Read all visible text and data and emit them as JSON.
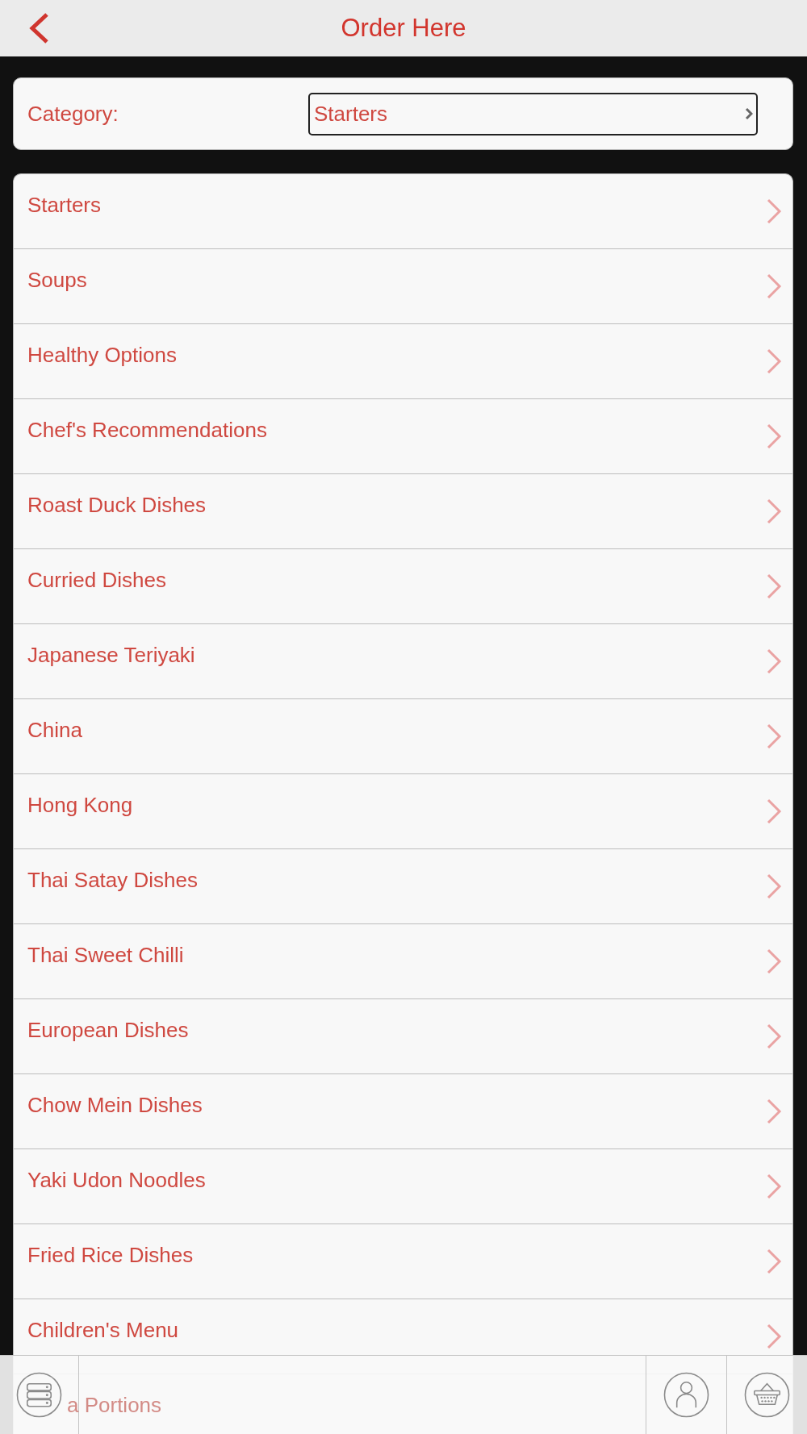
{
  "header": {
    "title": "Order Here"
  },
  "category": {
    "label": "Category:",
    "value": "Starters"
  },
  "menu_items": [
    {
      "label": "Starters"
    },
    {
      "label": "Soups"
    },
    {
      "label": "Healthy Options"
    },
    {
      "label": "Chef's Recommendations"
    },
    {
      "label": "Roast Duck Dishes"
    },
    {
      "label": "Curried Dishes"
    },
    {
      "label": "Japanese Teriyaki"
    },
    {
      "label": "China"
    },
    {
      "label": "Hong Kong"
    },
    {
      "label": "Thai Satay Dishes"
    },
    {
      "label": "Thai Sweet Chilli"
    },
    {
      "label": "European Dishes"
    },
    {
      "label": "Chow Mein Dishes"
    },
    {
      "label": "Yaki Udon Noodles"
    },
    {
      "label": "Fried Rice Dishes"
    },
    {
      "label": "Children's Menu"
    }
  ],
  "covered_item": {
    "label": "a Portions"
  }
}
